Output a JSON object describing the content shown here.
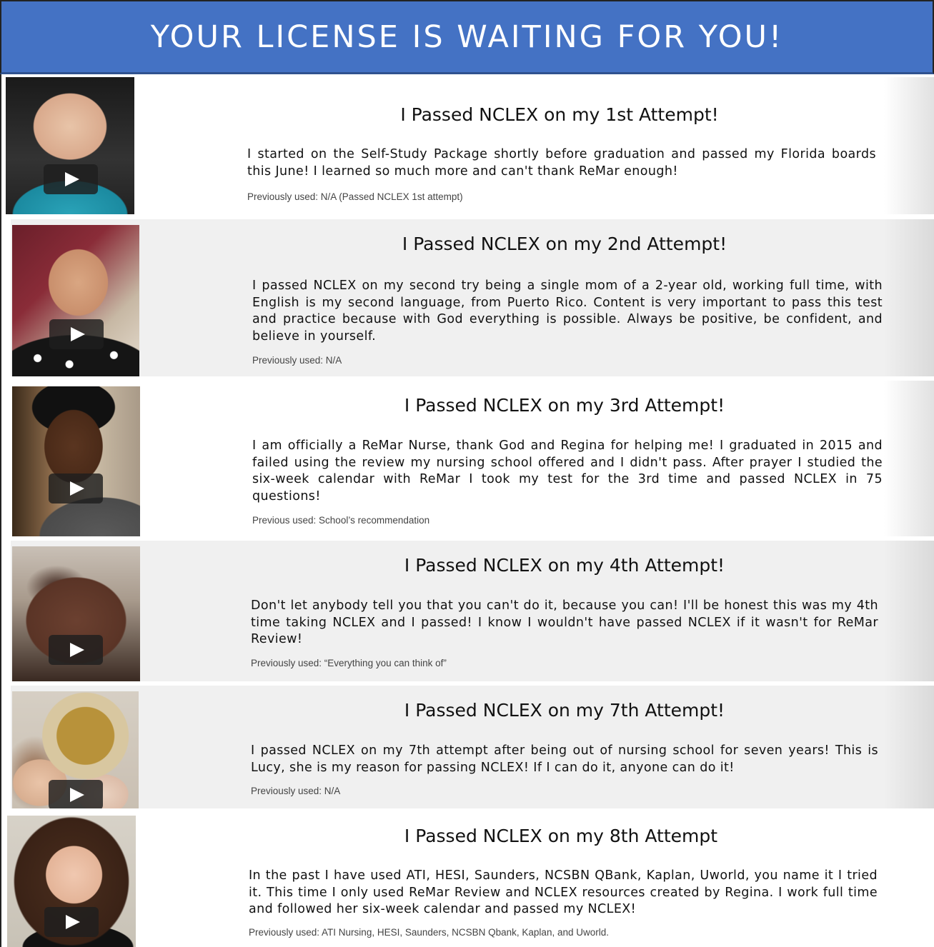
{
  "page": {
    "banner_title": "YOUR LICENSE IS WAITING FOR YOU!",
    "colors": {
      "banner": "#4472c4",
      "card_gray": "#f0f0f0",
      "card_white": "#ffffff"
    }
  },
  "testimonials": [
    {
      "heading": "I Passed NCLEX on my 1st Attempt!",
      "body": "I started on the Self-Study Package shortly before graduation and passed my Florida boards this June! I learned so much more and can't thank ReMar enough!",
      "previous": "Previously used: N/A (Passed NCLEX 1st attempt)",
      "video_icon": "play-icon"
    },
    {
      "heading": "I Passed NCLEX on my 2nd Attempt!",
      "body": "I passed NCLEX on my second try being a single mom of a 2-year old, working full time, with English is my second language, from Puerto Rico. Content is very important to pass this test and practice because with God everything is possible. Always be positive, be confident, and believe in yourself.",
      "previous": "Previously used: N/A",
      "video_icon": "play-icon"
    },
    {
      "heading": "I Passed NCLEX on my 3rd Attempt!",
      "body": "I am officially a ReMar Nurse, thank God and Regina for helping me! I graduated in 2015 and failed using the review my nursing school offered and I didn't pass. After prayer I studied the six-week calendar with ReMar I took my test for the 3rd time and passed NCLEX in 75 questions!",
      "previous": "Previous used: School’s recommendation",
      "video_icon": "play-icon"
    },
    {
      "heading": "I Passed NCLEX on my 4th Attempt!",
      "body": "Don't let anybody tell you that you can't do it, because you can! I'll be honest this was my 4th time taking NCLEX and I passed! I know I wouldn't have passed NCLEX if it wasn't for ReMar Review!",
      "previous": "Previously used: “Everything you can think of”",
      "video_icon": "play-icon"
    },
    {
      "heading": "I Passed NCLEX on my 7th Attempt!",
      "body": "I passed NCLEX on my 7th attempt after being out of nursing school for seven years! This is Lucy, she is my reason for passing NCLEX! If I can do it, anyone can do it!",
      "previous": "Previously used: N/A",
      "video_icon": "play-icon"
    },
    {
      "heading": "I Passed NCLEX on my 8th Attempt",
      "body": "In the past I have used ATI, HESI, Saunders, NCSBN QBank, Kaplan, Uworld, you name it I tried it. This time I only used ReMar Review and NCLEX resources created by Regina. I work full time and followed her six-week calendar and passed my NCLEX!",
      "previous": "Previously used: ATI Nursing, HESI, Saunders, NCSBN Qbank, Kaplan, and Uworld.",
      "video_icon": "play-icon"
    }
  ]
}
